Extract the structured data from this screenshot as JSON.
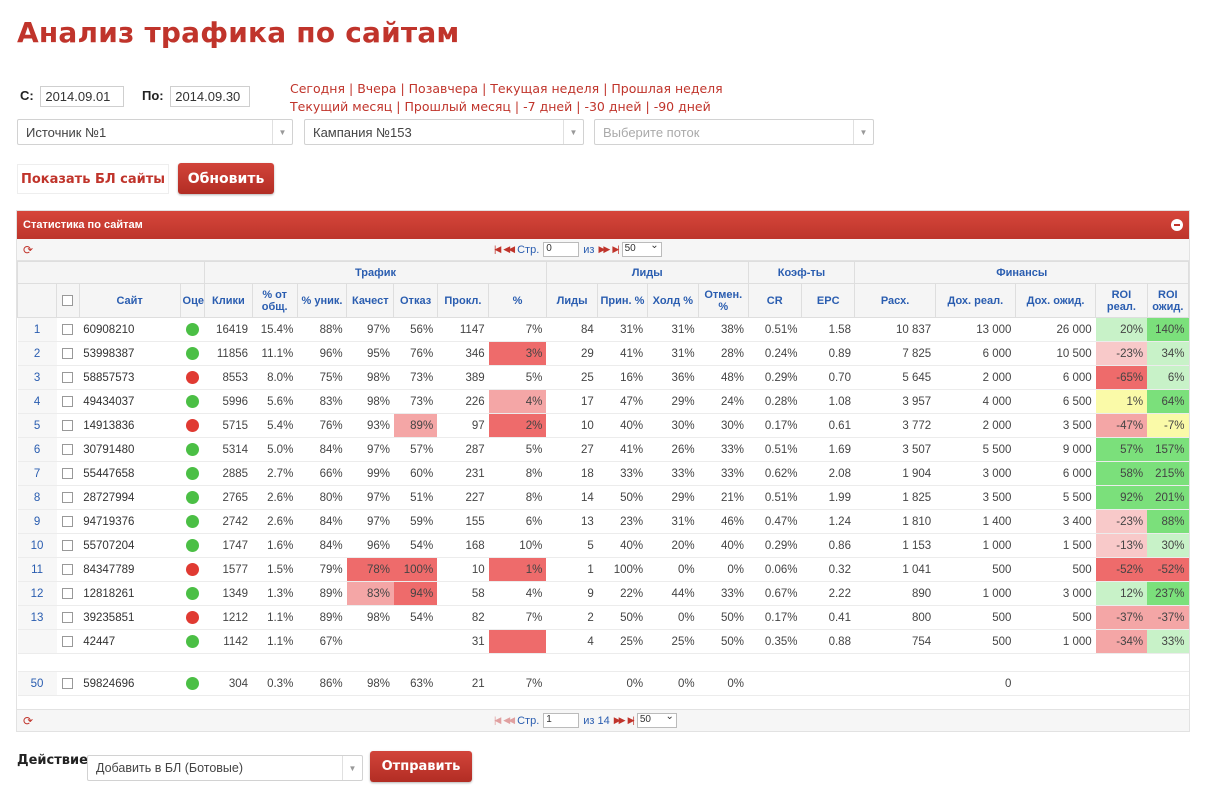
{
  "page": {
    "title": "Анализ трафика по сайтам"
  },
  "filters": {
    "from_label": "С:",
    "from_value": "2014.09.01",
    "to_label": "По:",
    "to_value": "2014.09.30",
    "quick_links": [
      [
        "Сегодня",
        "Вчера",
        "Позавчера",
        "Текущая неделя",
        "Прошлая неделя"
      ],
      [
        "Текущий месяц",
        "Прошлый месяц",
        "-7 дней",
        "-30 дней",
        "-90 дней"
      ]
    ],
    "source": "Источник №1",
    "campaign": "Кампания №153",
    "flow_placeholder": "Выберите поток"
  },
  "buttons": {
    "show_bl": "Показать БЛ сайты",
    "update": "Обновить",
    "send": "Отправить"
  },
  "panel": {
    "title": "Статистика по сайтам",
    "pager_top": {
      "page_label": "Стр.",
      "page_value": "0",
      "of_label": "из",
      "rows": "50"
    },
    "pager_bottom": {
      "page_label": "Стр.",
      "page_value": "1",
      "of_label": "из 14",
      "rows": "50"
    }
  },
  "columns": {
    "groups": {
      "traffic": "Трафик",
      "leads": "Лиды",
      "coef": "Коэф-ты",
      "finance": "Финансы"
    },
    "headers": [
      "Сайт",
      "Оце",
      "Клики",
      "% от общ.",
      "% уник.",
      "Качест",
      "Отказ",
      "Прокл.",
      "%",
      "Лиды",
      "Прин. %",
      "Холд %",
      "Отмен. %",
      "CR",
      "EPC",
      "Расх.",
      "Дох. реал.",
      "Дох. ожид.",
      "ROI реал.",
      "ROI ожид."
    ]
  },
  "colors": {
    "green": "#4bbf45",
    "red": "#e03a32",
    "bg_red": "#ee6b6b",
    "bg_pink": "#f4a6a6",
    "bg_lightpink": "#f8c9c9",
    "bg_green": "#7be07b",
    "bg_lightgreen": "#c8f2c8",
    "bg_yellow": "#fafaa8"
  },
  "rows": [
    {
      "n": "1",
      "site": "60908210",
      "oc": "green",
      "clicks": "16419",
      "pct": "15.4%",
      "uniq": "88%",
      "qual": "97%",
      "ref": "56%",
      "prokl": "1147",
      "prokl_pct": "7%",
      "leads": "84",
      "acc": "31%",
      "hold": "31%",
      "canc": "38%",
      "cr": "0.51%",
      "epc": "1.58",
      "exp": "10 837",
      "inc_real": "13 000",
      "inc_exp": "26 000",
      "roi_r": "20%",
      "roi_e": "140%",
      "bg": {
        "roi_r": "bg_lightgreen",
        "roi_e": "bg_green"
      }
    },
    {
      "n": "2",
      "site": "53998387",
      "oc": "green",
      "clicks": "11856",
      "pct": "11.1%",
      "uniq": "96%",
      "qual": "95%",
      "ref": "76%",
      "prokl": "346",
      "prokl_pct": "3%",
      "leads": "29",
      "acc": "41%",
      "hold": "31%",
      "canc": "28%",
      "cr": "0.24%",
      "epc": "0.89",
      "exp": "7 825",
      "inc_real": "6 000",
      "inc_exp": "10 500",
      "roi_r": "-23%",
      "roi_e": "34%",
      "bg": {
        "prokl_pct": "bg_red",
        "roi_r": "bg_lightpink",
        "roi_e": "bg_lightgreen"
      }
    },
    {
      "n": "3",
      "site": "58857573",
      "oc": "red",
      "clicks": "8553",
      "pct": "8.0%",
      "uniq": "75%",
      "qual": "98%",
      "ref": "73%",
      "prokl": "389",
      "prokl_pct": "5%",
      "leads": "25",
      "acc": "16%",
      "hold": "36%",
      "canc": "48%",
      "cr": "0.29%",
      "epc": "0.70",
      "exp": "5 645",
      "inc_real": "2 000",
      "inc_exp": "6 000",
      "roi_r": "-65%",
      "roi_e": "6%",
      "bg": {
        "roi_r": "bg_red",
        "roi_e": "bg_lightgreen"
      }
    },
    {
      "n": "4",
      "site": "49434037",
      "oc": "green",
      "clicks": "5996",
      "pct": "5.6%",
      "uniq": "83%",
      "qual": "98%",
      "ref": "73%",
      "prokl": "226",
      "prokl_pct": "4%",
      "leads": "17",
      "acc": "47%",
      "hold": "29%",
      "canc": "24%",
      "cr": "0.28%",
      "epc": "1.08",
      "exp": "3 957",
      "inc_real": "4 000",
      "inc_exp": "6 500",
      "roi_r": "1%",
      "roi_e": "64%",
      "bg": {
        "prokl_pct": "bg_pink",
        "roi_r": "bg_yellow",
        "roi_e": "bg_green"
      }
    },
    {
      "n": "5",
      "site": "14913836",
      "oc": "red",
      "clicks": "5715",
      "pct": "5.4%",
      "uniq": "76%",
      "qual": "93%",
      "ref": "89%",
      "prokl": "97",
      "prokl_pct": "2%",
      "leads": "10",
      "acc": "40%",
      "hold": "30%",
      "canc": "30%",
      "cr": "0.17%",
      "epc": "0.61",
      "exp": "3 772",
      "inc_real": "2 000",
      "inc_exp": "3 500",
      "roi_r": "-47%",
      "roi_e": "-7%",
      "bg": {
        "ref": "bg_pink",
        "prokl_pct": "bg_red",
        "roi_r": "bg_pink",
        "roi_e": "bg_yellow"
      }
    },
    {
      "n": "6",
      "site": "30791480",
      "oc": "green",
      "clicks": "5314",
      "pct": "5.0%",
      "uniq": "84%",
      "qual": "97%",
      "ref": "57%",
      "prokl": "287",
      "prokl_pct": "5%",
      "leads": "27",
      "acc": "41%",
      "hold": "26%",
      "canc": "33%",
      "cr": "0.51%",
      "epc": "1.69",
      "exp": "3 507",
      "inc_real": "5 500",
      "inc_exp": "9 000",
      "roi_r": "57%",
      "roi_e": "157%",
      "bg": {
        "roi_r": "bg_green",
        "roi_e": "bg_green"
      }
    },
    {
      "n": "7",
      "site": "55447658",
      "oc": "green",
      "clicks": "2885",
      "pct": "2.7%",
      "uniq": "66%",
      "qual": "99%",
      "ref": "60%",
      "prokl": "231",
      "prokl_pct": "8%",
      "leads": "18",
      "acc": "33%",
      "hold": "33%",
      "canc": "33%",
      "cr": "0.62%",
      "epc": "2.08",
      "exp": "1 904",
      "inc_real": "3 000",
      "inc_exp": "6 000",
      "roi_r": "58%",
      "roi_e": "215%",
      "bg": {
        "roi_r": "bg_green",
        "roi_e": "bg_green"
      }
    },
    {
      "n": "8",
      "site": "28727994",
      "oc": "green",
      "clicks": "2765",
      "pct": "2.6%",
      "uniq": "80%",
      "qual": "97%",
      "ref": "51%",
      "prokl": "227",
      "prokl_pct": "8%",
      "leads": "14",
      "acc": "50%",
      "hold": "29%",
      "canc": "21%",
      "cr": "0.51%",
      "epc": "1.99",
      "exp": "1 825",
      "inc_real": "3 500",
      "inc_exp": "5 500",
      "roi_r": "92%",
      "roi_e": "201%",
      "bg": {
        "roi_r": "bg_green",
        "roi_e": "bg_green"
      }
    },
    {
      "n": "9",
      "site": "94719376",
      "oc": "green",
      "clicks": "2742",
      "pct": "2.6%",
      "uniq": "84%",
      "qual": "97%",
      "ref": "59%",
      "prokl": "155",
      "prokl_pct": "6%",
      "leads": "13",
      "acc": "23%",
      "hold": "31%",
      "canc": "46%",
      "cr": "0.47%",
      "epc": "1.24",
      "exp": "1 810",
      "inc_real": "1 400",
      "inc_exp": "3 400",
      "roi_r": "-23%",
      "roi_e": "88%",
      "bg": {
        "roi_r": "bg_lightpink",
        "roi_e": "bg_green"
      }
    },
    {
      "n": "10",
      "site": "55707204",
      "oc": "green",
      "clicks": "1747",
      "pct": "1.6%",
      "uniq": "84%",
      "qual": "96%",
      "ref": "54%",
      "prokl": "168",
      "prokl_pct": "10%",
      "leads": "5",
      "acc": "40%",
      "hold": "20%",
      "canc": "40%",
      "cr": "0.29%",
      "epc": "0.86",
      "exp": "1 153",
      "inc_real": "1 000",
      "inc_exp": "1 500",
      "roi_r": "-13%",
      "roi_e": "30%",
      "bg": {
        "roi_r": "bg_lightpink",
        "roi_e": "bg_lightgreen"
      }
    },
    {
      "n": "11",
      "site": "84347789",
      "oc": "red",
      "clicks": "1577",
      "pct": "1.5%",
      "uniq": "79%",
      "qual": "78%",
      "ref": "100%",
      "prokl": "10",
      "prokl_pct": "1%",
      "leads": "1",
      "acc": "100%",
      "hold": "0%",
      "canc": "0%",
      "cr": "0.06%",
      "epc": "0.32",
      "exp": "1 041",
      "inc_real": "500",
      "inc_exp": "500",
      "roi_r": "-52%",
      "roi_e": "-52%",
      "bg": {
        "qual": "bg_red",
        "ref": "bg_red",
        "prokl_pct": "bg_red",
        "roi_r": "bg_red",
        "roi_e": "bg_red"
      }
    },
    {
      "n": "12",
      "site": "12818261",
      "oc": "green",
      "clicks": "1349",
      "pct": "1.3%",
      "uniq": "89%",
      "qual": "83%",
      "ref": "94%",
      "prokl": "58",
      "prokl_pct": "4%",
      "leads": "9",
      "acc": "22%",
      "hold": "44%",
      "canc": "33%",
      "cr": "0.67%",
      "epc": "2.22",
      "exp": "890",
      "inc_real": "1 000",
      "inc_exp": "3 000",
      "roi_r": "12%",
      "roi_e": "237%",
      "bg": {
        "qual": "bg_pink",
        "ref": "bg_red",
        "roi_r": "bg_lightgreen",
        "roi_e": "bg_green"
      }
    },
    {
      "n": "13",
      "site": "39235851",
      "oc": "red",
      "clicks": "1212",
      "pct": "1.1%",
      "uniq": "89%",
      "qual": "98%",
      "ref": "54%",
      "prokl": "82",
      "prokl_pct": "7%",
      "leads": "2",
      "acc": "50%",
      "hold": "0%",
      "canc": "50%",
      "cr": "0.17%",
      "epc": "0.41",
      "exp": "800",
      "inc_real": "500",
      "inc_exp": "500",
      "roi_r": "-37%",
      "roi_e": "-37%",
      "bg": {
        "roi_r": "bg_pink",
        "roi_e": "bg_pink"
      }
    },
    {
      "n": "",
      "site": "42447",
      "oc": "green",
      "clicks": "1142",
      "pct": "1.1%",
      "uniq": "67%",
      "qual": "",
      "ref": "",
      "prokl": "31",
      "prokl_pct": "",
      "leads": "4",
      "acc": "25%",
      "hold": "25%",
      "canc": "50%",
      "cr": "0.35%",
      "epc": "0.88",
      "exp": "754",
      "inc_real": "500",
      "inc_exp": "1 000",
      "roi_r": "-34%",
      "roi_e": "33%",
      "bg": {
        "prokl_pct": "bg_red",
        "roi_r": "bg_pink",
        "roi_e": "bg_lightgreen"
      }
    },
    {
      "n": "50",
      "site": "59824696",
      "oc": "green",
      "clicks": "304",
      "pct": "0.3%",
      "uniq": "86%",
      "qual": "98%",
      "ref": "63%",
      "prokl": "21",
      "prokl_pct": "7%",
      "leads": "",
      "acc": "0%",
      "hold": "0%",
      "canc": "0%",
      "cr": "",
      "epc": "",
      "exp": "",
      "inc_real": "0",
      "inc_exp": "",
      "roi_r": "",
      "roi_e": "",
      "bg": {}
    }
  ],
  "actions": {
    "label": "Действие:",
    "selected": "Добавить в БЛ (Ботовые)"
  }
}
